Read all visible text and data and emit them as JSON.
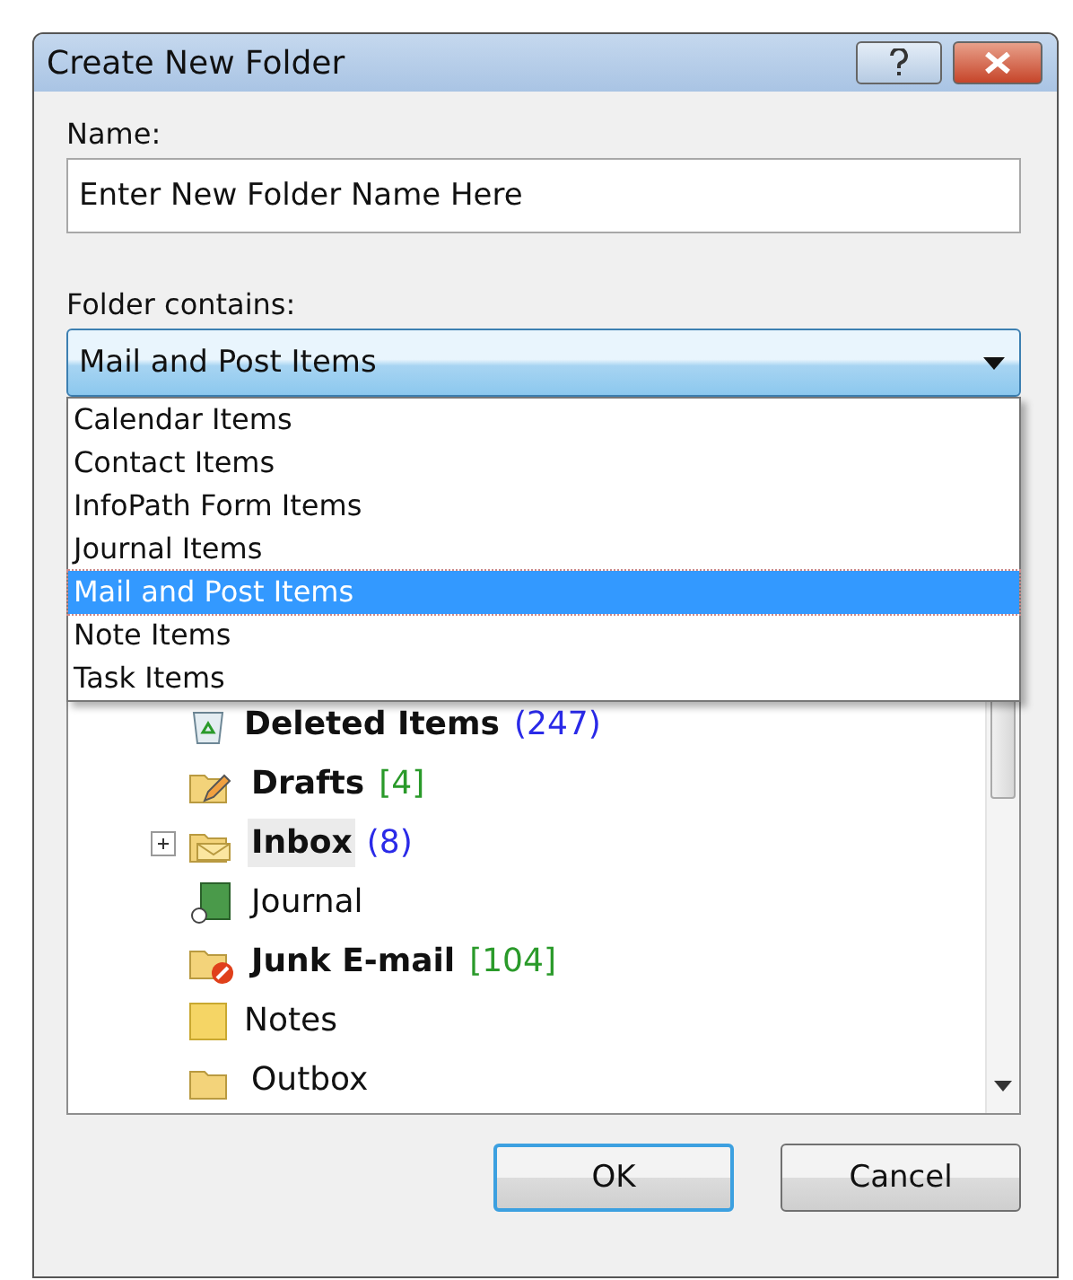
{
  "window": {
    "title": "Create New Folder"
  },
  "name_field": {
    "label": "Name:",
    "value": "Enter New Folder Name Here"
  },
  "contains_combo": {
    "label": "Folder contains:",
    "value": "Mail and Post Items",
    "expanded": true,
    "options": [
      {
        "label": "Calendar Items",
        "selected": false
      },
      {
        "label": "Contact Items",
        "selected": false
      },
      {
        "label": "InfoPath Form Items",
        "selected": false
      },
      {
        "label": "Journal Items",
        "selected": false
      },
      {
        "label": "Mail and Post Items",
        "selected": true
      },
      {
        "label": "Note Items",
        "selected": false
      },
      {
        "label": "Task Items",
        "selected": false
      }
    ]
  },
  "folder_tree": {
    "items": [
      {
        "kind": "deleted",
        "name": "Deleted Items",
        "count": "(247)",
        "color": "#2a2ae8",
        "unread": true,
        "selected": false,
        "expandable": false
      },
      {
        "kind": "drafts",
        "name": "Drafts",
        "count": "[4]",
        "color": "#2a9a2a",
        "unread": true,
        "selected": false,
        "expandable": false
      },
      {
        "kind": "inbox",
        "name": "Inbox",
        "count": "(8)",
        "color": "#2a2ae8",
        "unread": true,
        "selected": true,
        "expandable": true
      },
      {
        "kind": "journal",
        "name": "Journal",
        "unread": false,
        "selected": false,
        "expandable": false
      },
      {
        "kind": "junk",
        "name": "Junk E-mail",
        "count": "[104]",
        "color": "#2a9a2a",
        "unread": true,
        "selected": false,
        "expandable": false
      },
      {
        "kind": "notes",
        "name": "Notes",
        "unread": false,
        "selected": false,
        "expandable": false
      },
      {
        "kind": "outbox",
        "name": "Outbox",
        "unread": false,
        "selected": false,
        "expandable": false
      }
    ]
  },
  "buttons": [
    {
      "label": "OK",
      "default": true
    },
    {
      "label": "Cancel",
      "default": false
    }
  ]
}
